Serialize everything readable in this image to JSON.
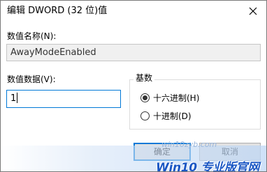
{
  "window": {
    "title": "编辑 DWORD (32 位)值",
    "close_glyph": "close-icon"
  },
  "value_name": {
    "label": "数值名称(N):",
    "value": "AwayModeEnabled"
  },
  "value_data": {
    "label": "数值数据(V):",
    "value": "1"
  },
  "base": {
    "label": "基数",
    "options": [
      {
        "label": "十六进制(H)",
        "checked": true
      },
      {
        "label": "十进制(D)",
        "checked": false
      }
    ]
  },
  "buttons": {
    "ok": "确定",
    "cancel": "取消"
  },
  "watermark": {
    "text": "Win10 专业版官网",
    "url": "win10zyb.com"
  },
  "colors": {
    "accent": "#0078d7",
    "watermark": "#1a57c4"
  }
}
